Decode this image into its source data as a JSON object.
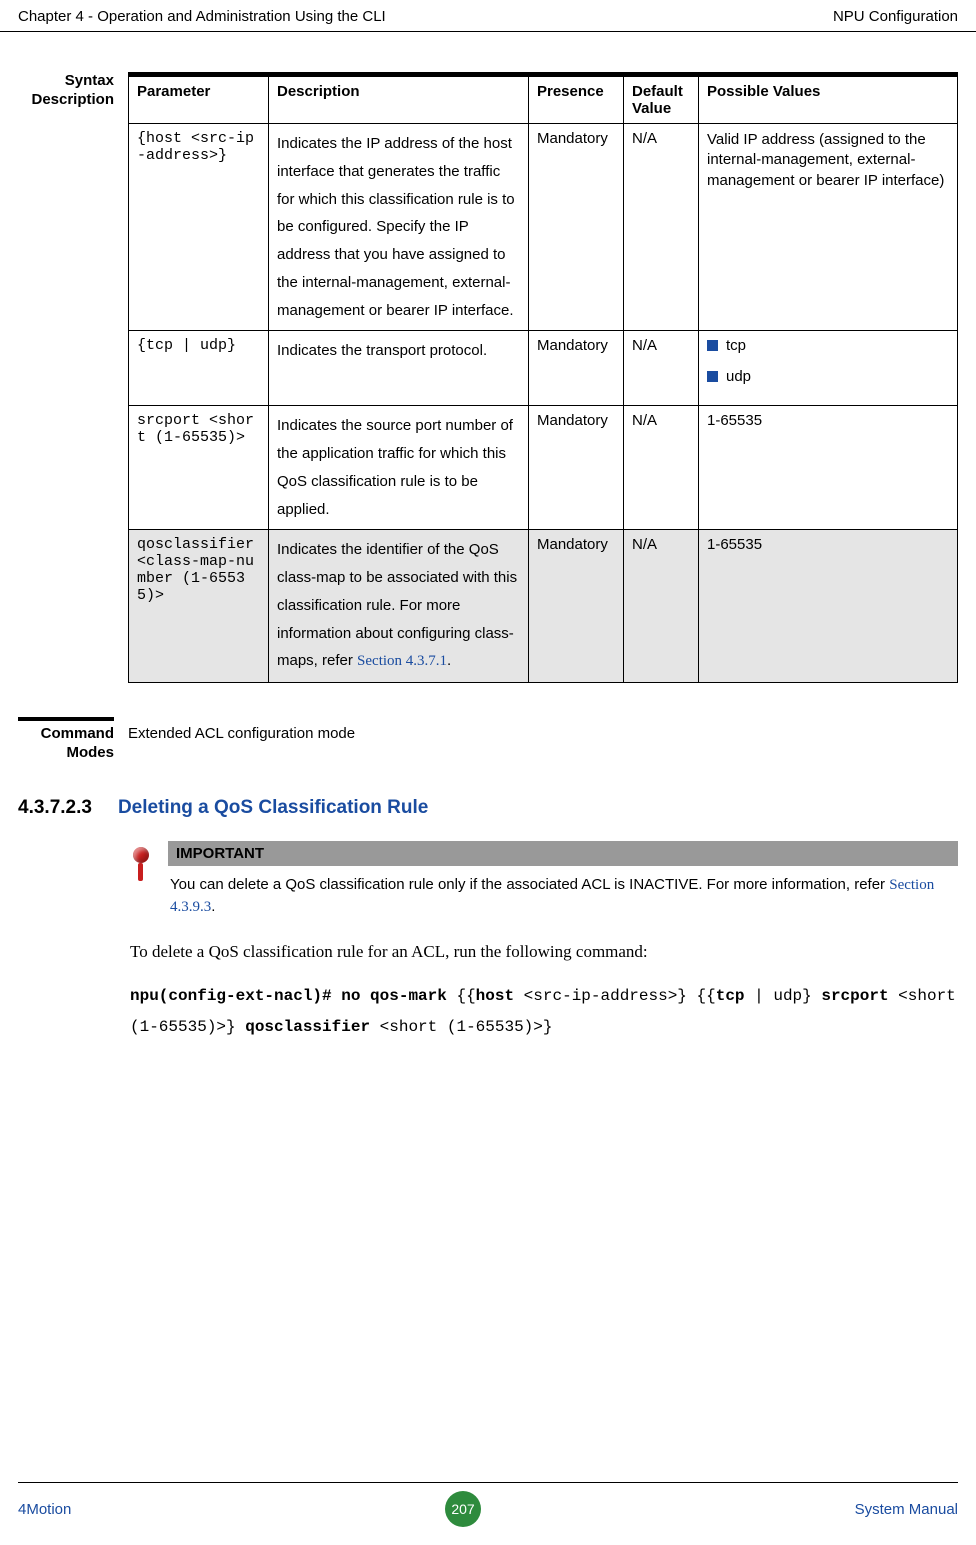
{
  "header": {
    "left": "Chapter 4 - Operation and Administration Using the CLI",
    "right": "NPU Configuration"
  },
  "syntax": {
    "label": "Syntax Description",
    "columns": [
      "Parameter",
      "Description",
      "Presence",
      "Default Value",
      "Possible Values"
    ],
    "rows": [
      {
        "param": "{host <src-ip-address>}",
        "desc": "Indicates the IP address of the host interface that generates the traffic for which this classification rule is to be configured. Specify the IP address that you have assigned to the internal-management, external-management or bearer IP interface.",
        "presence": "Mandatory",
        "def": "N/A",
        "values_plain": "Valid IP address (assigned to the internal-management, external-management or bearer IP interface)",
        "values_bullets": []
      },
      {
        "param": "{tcp | udp}",
        "desc": "Indicates the transport protocol.",
        "presence": "Mandatory",
        "def": "N/A",
        "values_plain": "",
        "values_bullets": [
          "tcp",
          "udp"
        ]
      },
      {
        "param": "srcport <short (1-65535)>",
        "desc": "Indicates the source port number of the application traffic for which this QoS classification rule  is to be applied.",
        "presence": "Mandatory",
        "def": "N/A",
        "values_plain": "1-65535",
        "values_bullets": []
      },
      {
        "param": "qosclassifier <class-map-number (1-65535)>",
        "desc_prefix": "Indicates the identifier of the QoS class-map to be associated with this classification rule. For more information about configuring class-maps, refer ",
        "desc_link": "Section 4.3.7.1",
        "desc_suffix": ".",
        "presence": "Mandatory",
        "def": "N/A",
        "values_plain": "1-65535",
        "values_bullets": []
      }
    ]
  },
  "command_modes": {
    "label": "Command Modes",
    "value": "Extended ACL configuration mode"
  },
  "subhead": {
    "num": "4.3.7.2.3",
    "title": "Deleting a QoS Classification Rule"
  },
  "callout": {
    "header": "IMPORTANT",
    "text_prefix": "You can delete a QoS classification rule only if the associated ACL is INACTIVE. For more information, refer ",
    "link": "Section 4.3.9.3",
    "text_suffix": "."
  },
  "paragraph": "To delete a QoS classification rule for an ACL, run the following command:",
  "command": {
    "p1": "npu(config-ext-nacl)# no qos-mark",
    "p2": " {{",
    "p3": "host",
    "p4": " <src-ip-address>} {{",
    "p5": "tcp",
    "p6": " | udp} ",
    "p7": "srcport",
    "p8": " <short (1-65535)>} ",
    "p9": "qosclassifier",
    "p10": " <short (1-65535)>}"
  },
  "footer": {
    "left": "4Motion",
    "page": "207",
    "right": "System Manual"
  }
}
